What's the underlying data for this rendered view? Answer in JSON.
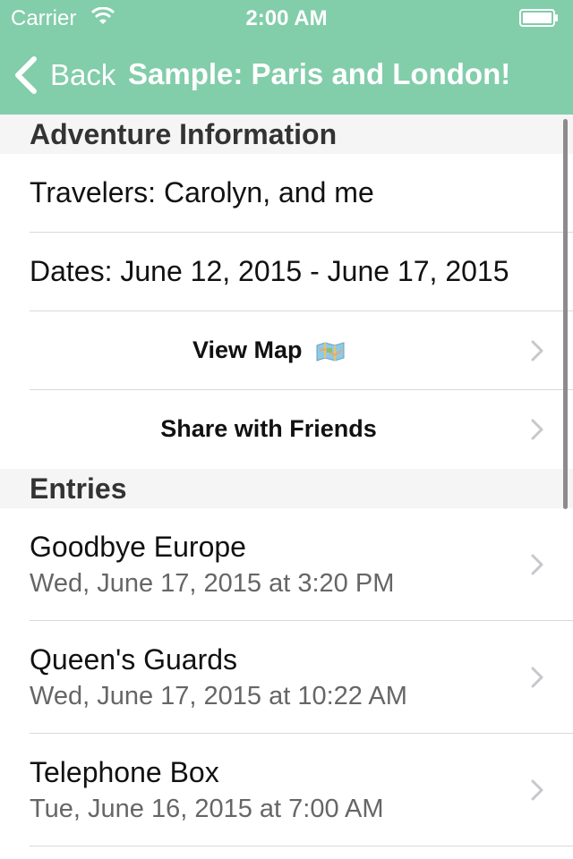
{
  "status_bar": {
    "carrier": "Carrier",
    "time": "2:00 AM"
  },
  "nav": {
    "back_label": "Back",
    "title": "Sample: Paris and London!"
  },
  "sections": {
    "info": {
      "title": "Adventure Information",
      "travelers": "Travelers: Carolyn, and me",
      "dates": "Dates: June 12, 2015 - June 17, 2015",
      "view_map": "View Map",
      "share": "Share with Friends"
    },
    "entries": {
      "title": "Entries",
      "items": [
        {
          "title": "Goodbye Europe",
          "date": "Wed, June 17, 2015 at 3:20 PM"
        },
        {
          "title": "Queen's Guards",
          "date": "Wed, June 17, 2015 at 10:22 AM"
        },
        {
          "title": "Telephone Box",
          "date": "Tue, June 16, 2015 at 7:00 AM"
        }
      ]
    }
  },
  "colors": {
    "header_bg": "#82cdaa",
    "section_bg": "#f5f5f5",
    "secondary_text": "#666666"
  },
  "icons": [
    "wifi-icon",
    "battery-icon",
    "back-chevron-icon",
    "map-icon",
    "chevron-right-icon"
  ]
}
